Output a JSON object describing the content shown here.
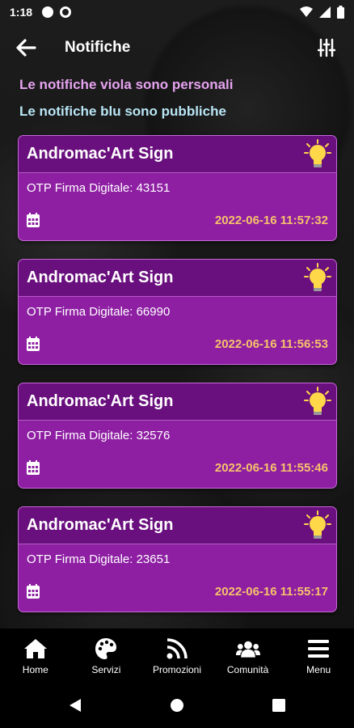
{
  "status_bar": {
    "time": "1:18"
  },
  "app_bar": {
    "title": "Notifiche"
  },
  "legend": {
    "purple": "Le notifiche viola sono personali",
    "blue": "Le notifiche blu sono pubbliche"
  },
  "colors": {
    "personal": "#8e1fa3",
    "header": "#6a0f7e",
    "date": "#f6c26b"
  },
  "notifications": [
    {
      "title": "Andromac'Art Sign",
      "message": "OTP Firma Digitale: 43151",
      "date": "2022-06-16 11:57:32"
    },
    {
      "title": "Andromac'Art Sign",
      "message": "OTP Firma Digitale: 66990",
      "date": "2022-06-16 11:56:53"
    },
    {
      "title": "Andromac'Art Sign",
      "message": "OTP Firma Digitale: 32576",
      "date": "2022-06-16 11:55:46"
    },
    {
      "title": "Andromac'Art Sign",
      "message": "OTP Firma Digitale: 23651",
      "date": "2022-06-16 11:55:17"
    }
  ],
  "nav": [
    {
      "label": "Home",
      "icon": "home-icon"
    },
    {
      "label": "Servizi",
      "icon": "palette-icon"
    },
    {
      "label": "Promozioni",
      "icon": "rss-icon"
    },
    {
      "label": "Comunità",
      "icon": "users-icon"
    },
    {
      "label": "Menu",
      "icon": "menu-icon"
    }
  ]
}
